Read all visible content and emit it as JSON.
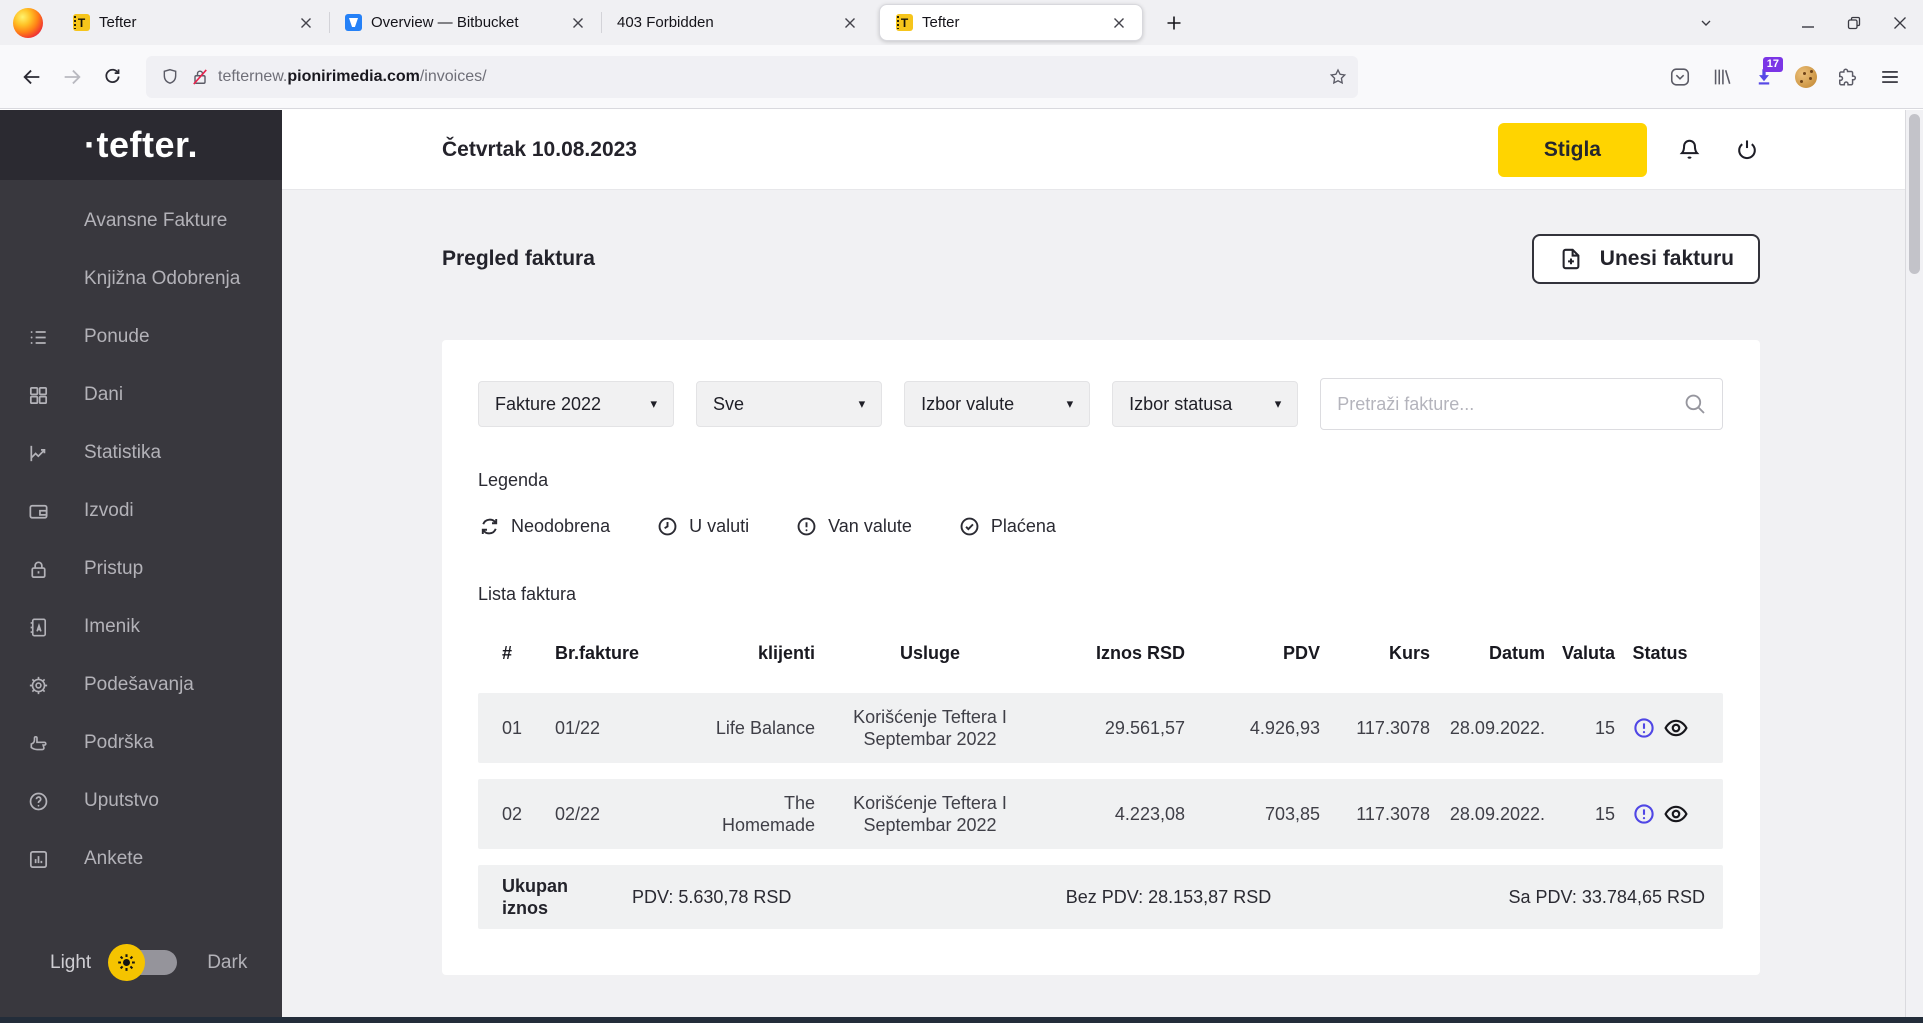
{
  "browser": {
    "tabs": [
      {
        "title": "Tefter"
      },
      {
        "title": "Overview — Bitbucket"
      },
      {
        "title": "403 Forbidden"
      },
      {
        "title": "Tefter"
      }
    ],
    "url": {
      "subdomain": "tefternew.",
      "domain": "pionirimedia.com",
      "path": "/invoices/"
    },
    "downloads_badge": "17"
  },
  "sidebar": {
    "logo": "·tefter.",
    "items": [
      {
        "label": "Avansne Fakture",
        "icon": ""
      },
      {
        "label": "Knjižna Odobrenja",
        "icon": ""
      },
      {
        "label": "Ponude",
        "icon": "list-icon"
      },
      {
        "label": "Dani",
        "icon": "grid-icon"
      },
      {
        "label": "Statistika",
        "icon": "chart-icon"
      },
      {
        "label": "Izvodi",
        "icon": "wallet-icon"
      },
      {
        "label": "Pristup",
        "icon": "lock-icon"
      },
      {
        "label": "Imenik",
        "icon": "address-book-icon"
      },
      {
        "label": "Podešavanja",
        "icon": "gear-icon"
      },
      {
        "label": "Podrška",
        "icon": "support-hand-icon"
      },
      {
        "label": "Uputstvo",
        "icon": "help-icon"
      },
      {
        "label": "Ankete",
        "icon": "survey-icon"
      }
    ],
    "theme_toggle": {
      "light_label": "Light",
      "dark_label": "Dark"
    }
  },
  "header": {
    "date": "Četvrtak 10.08.2023",
    "status_button": "Stigla"
  },
  "main": {
    "page_title": "Pregled faktura",
    "add_invoice_button": "Unesi fakturu",
    "filters": {
      "year": "Fakture 2022",
      "type": "Sve",
      "currency": "Izbor valute",
      "status": "Izbor statusa",
      "search_placeholder": "Pretraži fakture..."
    },
    "legend": {
      "title": "Legenda",
      "items": [
        {
          "label": "Neodobrena",
          "icon": "sync-icon"
        },
        {
          "label": "U valuti",
          "icon": "clock-icon"
        },
        {
          "label": "Van valute",
          "icon": "exclamation-icon"
        },
        {
          "label": "Plaćena",
          "icon": "check-icon"
        }
      ]
    },
    "table": {
      "title": "Lista faktura",
      "columns": [
        "#",
        "Br.fakture",
        "klijenti",
        "Usluge",
        "Iznos RSD",
        "PDV",
        "Kurs",
        "Datum",
        "Valuta",
        "Status"
      ],
      "rows": [
        {
          "num": "01",
          "br_fakture": "01/22",
          "klijent": "Life Balance",
          "usluga": "Korišćenje Teftera I Septembar 2022",
          "iznos_rsd": "29.561,57",
          "pdv": "4.926,93",
          "kurs": "117.3078",
          "datum": "28.09.2022.",
          "valuta": "15",
          "status_icon": "van-valute-icon"
        },
        {
          "num": "02",
          "br_fakture": "02/22",
          "klijent": "The Homemade",
          "usluga": "Korišćenje Teftera I Septembar 2022",
          "iznos_rsd": "4.223,08",
          "pdv": "703,85",
          "kurs": "117.3078",
          "datum": "28.09.2022.",
          "valuta": "15",
          "status_icon": "van-valute-icon"
        }
      ],
      "totals": {
        "label": "Ukupan iznos",
        "pdv": "PDV: 5.630,78 RSD",
        "bez_pdv": "Bez PDV: 28.153,87 RSD",
        "sa_pdv": "Sa PDV: 33.784,65 RSD"
      }
    }
  },
  "colors": {
    "accent_yellow": "#ffd400",
    "status_purple": "#4f46e5",
    "sidebar_bg": "#39383e",
    "row_gray": "#f0f1f2"
  }
}
